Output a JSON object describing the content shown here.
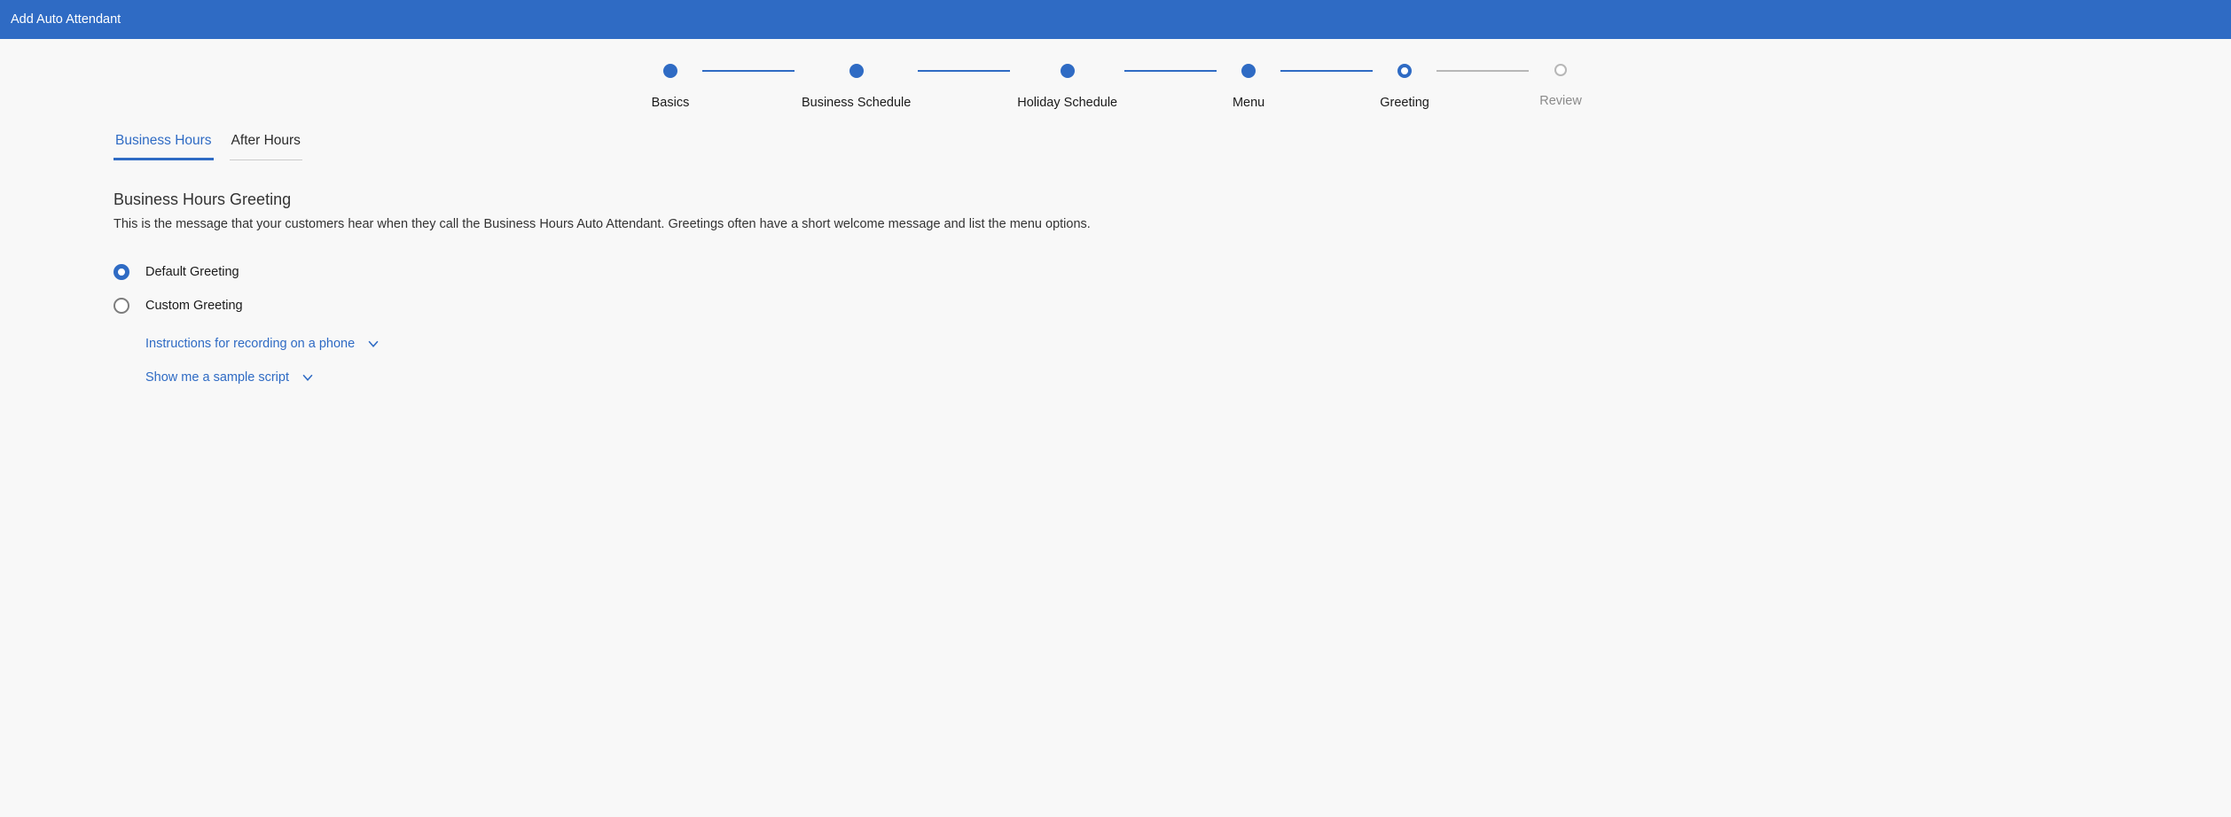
{
  "header": {
    "title": "Add Auto Attendant"
  },
  "stepper": {
    "steps": [
      {
        "label": "Basics",
        "state": "done"
      },
      {
        "label": "Business Schedule",
        "state": "done"
      },
      {
        "label": "Holiday Schedule",
        "state": "done"
      },
      {
        "label": "Menu",
        "state": "done"
      },
      {
        "label": "Greeting",
        "state": "current"
      },
      {
        "label": "Review",
        "state": "future"
      }
    ]
  },
  "tabs": {
    "items": [
      {
        "label": "Business Hours",
        "active": true
      },
      {
        "label": "After Hours",
        "active": false
      }
    ]
  },
  "section": {
    "title": "Business Hours Greeting",
    "description": "This is the message that your customers hear when they call the Business Hours Auto Attendant. Greetings often have a short welcome message and list the menu options."
  },
  "greeting": {
    "options": [
      {
        "label": "Default Greeting",
        "selected": true
      },
      {
        "label": "Custom Greeting",
        "selected": false
      }
    ]
  },
  "links": {
    "instructions": "Instructions for recording on a phone",
    "sample": "Show me a sample script"
  }
}
